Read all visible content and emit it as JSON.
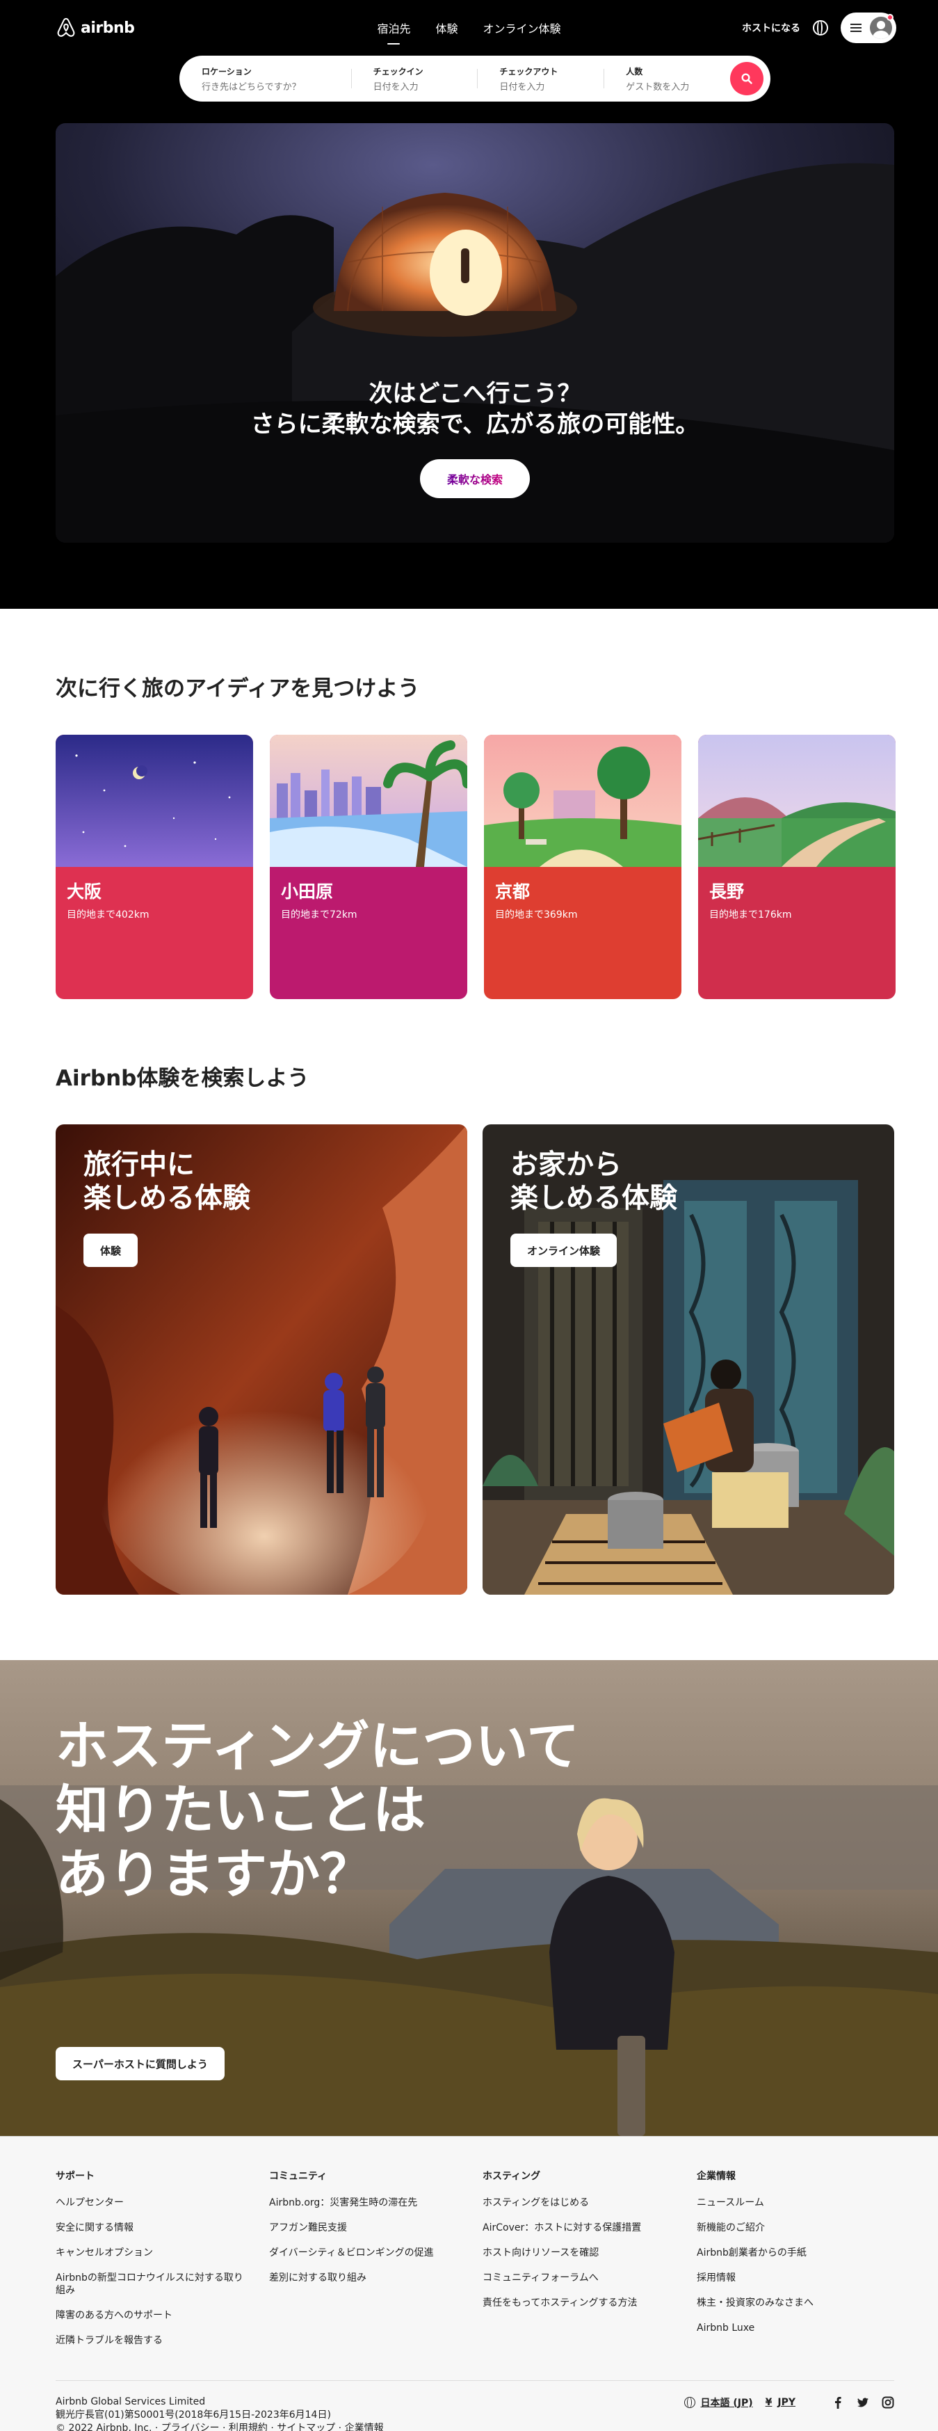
{
  "nav": {
    "logo_text": "airbnb",
    "tabs": [
      {
        "label": "宿泊先",
        "active": true
      },
      {
        "label": "体験",
        "active": false
      },
      {
        "label": "オンライン体験",
        "active": false
      }
    ],
    "become_host": "ホストになる"
  },
  "search": {
    "location_label": "ロケーション",
    "location_placeholder": "行き先はどちらですか？",
    "checkin_label": "チェックイン",
    "checkin_placeholder": "日付を入力",
    "checkout_label": "チェックアウト",
    "checkout_placeholder": "日付を入力",
    "guests_label": "人数",
    "guests_placeholder": "ゲスト数を入力"
  },
  "hero": {
    "title_line1": "次はどこへ行こう？",
    "title_line2": "さらに柔軟な検索で、広がる旅の可能性。",
    "button_label": "柔軟な検索"
  },
  "destinations": {
    "title": "次に行く旅のアイディアを見つけよう",
    "items": [
      {
        "name": "大阪",
        "distance": "目的地まで402km",
        "color": "#de3151"
      },
      {
        "name": "小田原",
        "distance": "目的地まで72km",
        "color": "#bc1a6e"
      },
      {
        "name": "京都",
        "distance": "目的地まで369km",
        "color": "#de3e31"
      },
      {
        "name": "長野",
        "distance": "目的地まで176km",
        "color": "#d02e4c"
      }
    ]
  },
  "experiences": {
    "title": "Airbnb体験を検索しよう",
    "items": [
      {
        "title_line1": "旅行中に",
        "title_line2": "楽しめる体験",
        "button_label": "体験"
      },
      {
        "title_line1": "お家から",
        "title_line2": "楽しめる体験",
        "button_label": "オンライン体験"
      }
    ]
  },
  "hosting": {
    "title_line1": "ホスティングについて",
    "title_line2": "知りたいことは",
    "title_line3": "ありますか？",
    "button_label": "スーパーホストに質問しよう"
  },
  "footer": {
    "columns": [
      {
        "heading": "サポート",
        "links": [
          "ヘルプセンター",
          "安全に関する情報",
          "キャンセルオプション",
          "Airbnbの新型コロナウイルスに対する取り組み",
          "障害のある方へのサポート",
          "近隣トラブルを報告する"
        ]
      },
      {
        "heading": "コミュニティ",
        "links": [
          "Airbnb.org：災害発生時の滞在先",
          "アフガン難民支援",
          "ダイバーシティ＆ビロンギングの促進",
          "差別に対する取り組み"
        ]
      },
      {
        "heading": "ホスティング",
        "links": [
          "ホスティングをはじめる",
          "AirCover：ホストに対する保護措置",
          "ホスト向けリソースを確認",
          "コミュニティフォーラムへ",
          "責任をもってホスティングする方法"
        ]
      },
      {
        "heading": "企業情報",
        "links": [
          "ニュースルーム",
          "新機能のご紹介",
          "Airbnb創業者からの手紙",
          "採用情報",
          "株主・投資家のみなさまへ",
          "Airbnb Luxe"
        ]
      }
    ],
    "company": "Airbnb Global Services Limited",
    "license": "観光庁長官(01)第S0001号(2018年6月15日-2023年6月14日)",
    "copyright": "© 2022 Airbnb, Inc. · プライバシー · 利用規約 · サイトマップ · 企業情報",
    "language": "日本語 (JP)",
    "currency_symbol": "¥",
    "currency": "JPY"
  },
  "colors": {
    "brand": "#ff385c",
    "hero_button_text": "#6e0f8e"
  }
}
